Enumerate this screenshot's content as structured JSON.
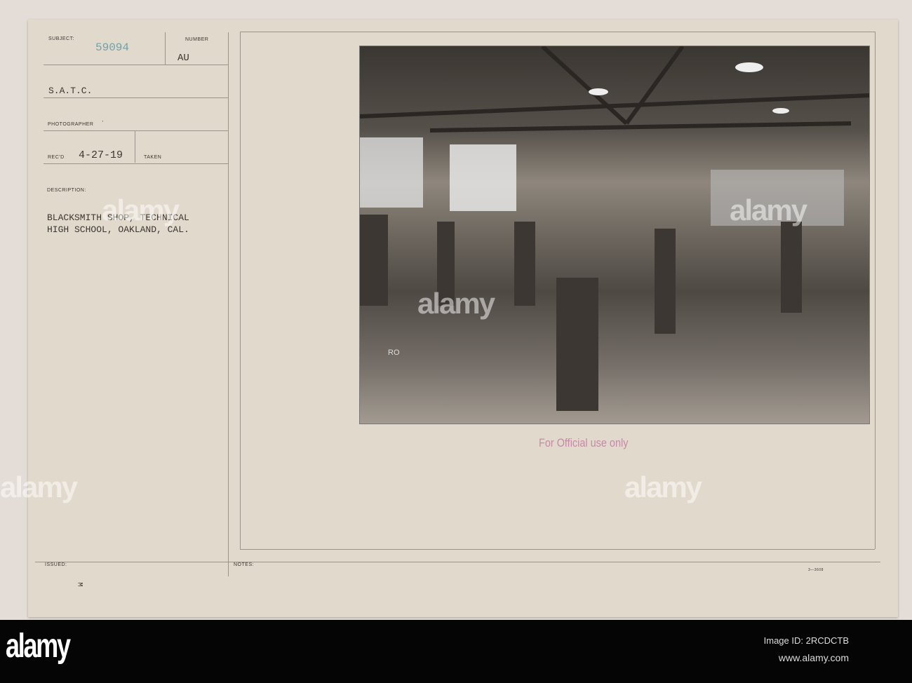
{
  "card": {
    "subject_label": "SUBJECT:",
    "subject_number": "59094",
    "number_label": "NUMBER",
    "number_value": "AU",
    "unit": "S.A.T.C.",
    "photographer_label": "PHOTOGRAPHER",
    "photographer_mark": "'",
    "recd_label": "REC'D",
    "recd_date": "4-27-19",
    "taken_label": "TAKEN",
    "description_label": "DESCRIPTION:",
    "description_line1": "BLACKSMITH SHOP, TECHNICAL",
    "description_line2": "HIGH SCHOOL, OAKLAND, CAL.",
    "issued_label": "ISSUED:",
    "issued_mark": "M",
    "notes_label": "NOTES:",
    "form_number": "3—3608"
  },
  "photo": {
    "caption_stamp": "For Official use only",
    "plate_mark": "RO"
  },
  "watermark": "alamy",
  "footer": {
    "logo": "alamy",
    "image_id": "Image ID: 2RCDCTB",
    "url": "www.alamy.com"
  }
}
